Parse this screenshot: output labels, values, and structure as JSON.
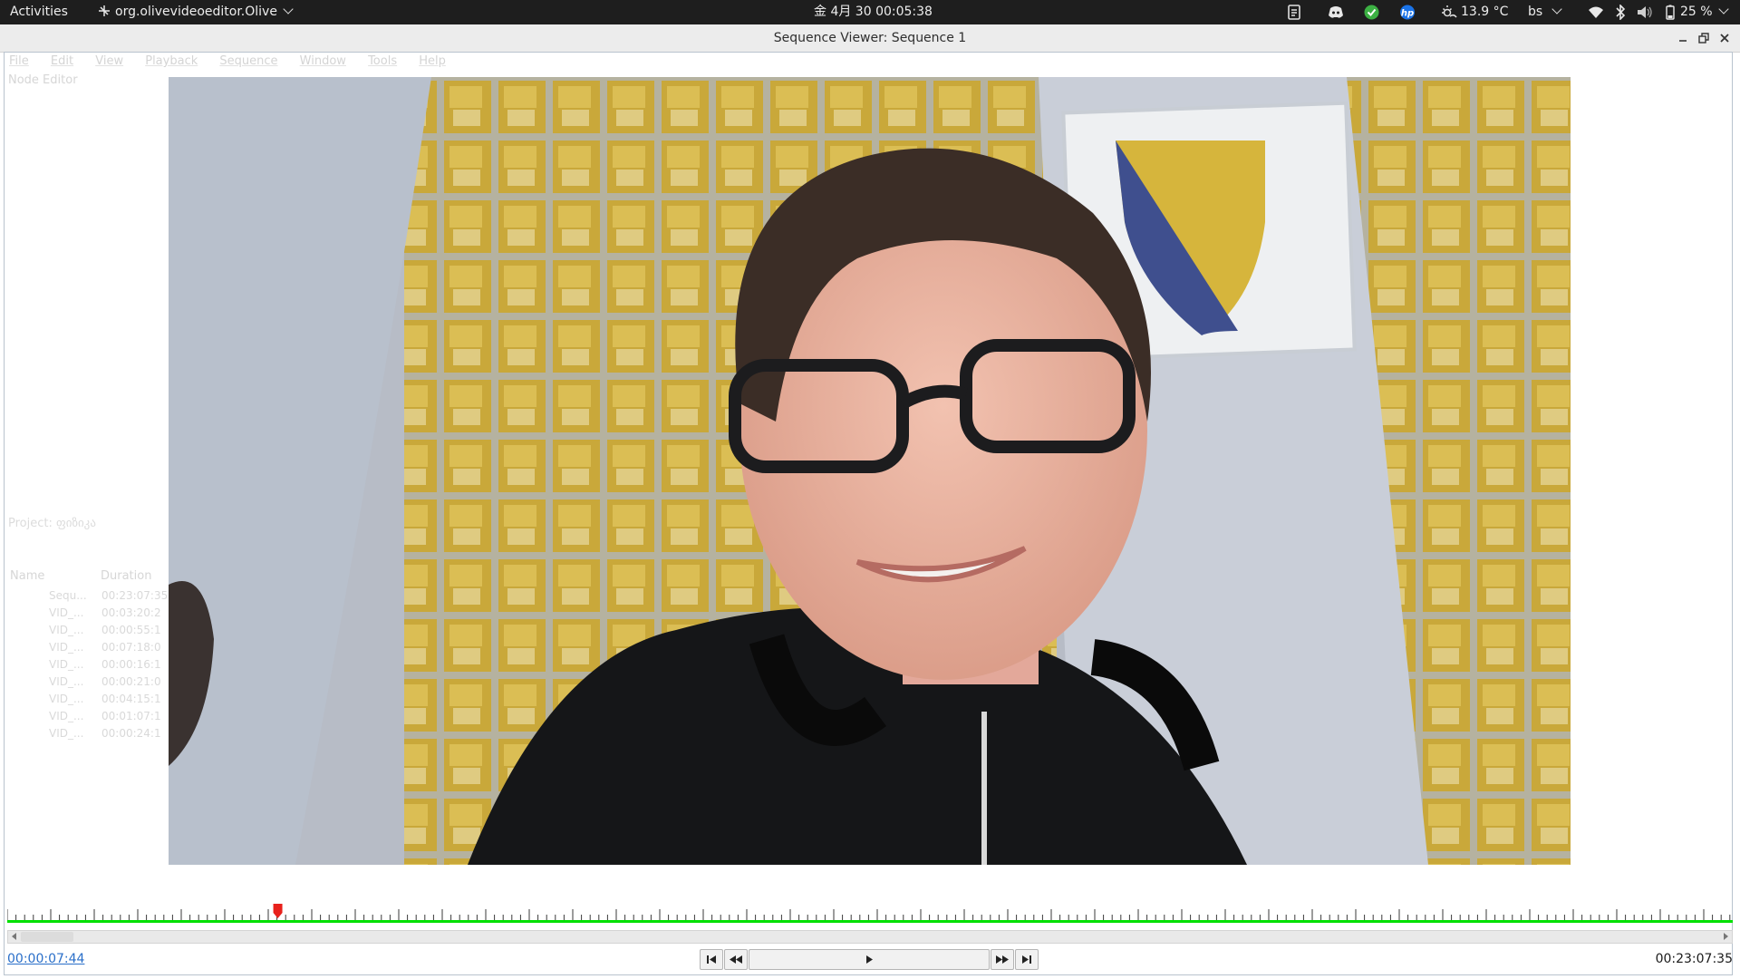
{
  "topbar": {
    "activities": "Activities",
    "app_name": "org.olivevideoeditor.Olive",
    "datetime": "金 4月 30  00:05:38",
    "temperature": "13.9 °C",
    "keyboard": "bs",
    "battery": "25 %",
    "tray_icons": [
      "notes-icon",
      "discord-icon",
      "check-icon",
      "hp-icon",
      "weather-icon",
      "wifi-icon",
      "bluetooth-icon",
      "volume-icon",
      "battery-icon"
    ]
  },
  "window": {
    "title": "Sequence Viewer: Sequence 1",
    "controls": [
      "minimize-icon",
      "restore-icon",
      "close-icon"
    ]
  },
  "menu": [
    "File",
    "Edit",
    "View",
    "Playback",
    "Sequence",
    "Window",
    "Tools",
    "Help"
  ],
  "panels": {
    "node_editor": "Node Editor",
    "project": "Project: ფიზიკა",
    "columns": [
      "Name",
      "Duration"
    ],
    "items": [
      {
        "name": "Sequ...",
        "duration": "00:23:07:35"
      },
      {
        "name": "VID_...",
        "duration": "00:03:20:2"
      },
      {
        "name": "VID_...",
        "duration": "00:00:55:1"
      },
      {
        "name": "VID_...",
        "duration": "00:07:18:0"
      },
      {
        "name": "VID_...",
        "duration": "00:00:16:1"
      },
      {
        "name": "VID_...",
        "duration": "00:00:21:0"
      },
      {
        "name": "VID_...",
        "duration": "00:04:15:1"
      },
      {
        "name": "VID_...",
        "duration": "00:01:07:1"
      },
      {
        "name": "VID_...",
        "duration": "00:00:24:1"
      }
    ]
  },
  "viewer": {
    "current_time": "00:00:07:44",
    "total_time": "00:23:07:35",
    "playhead_fraction": 0.0056,
    "accent_color": "#00e000",
    "playhead_color": "#e8211c",
    "buttons": [
      "go-to-start",
      "previous-frame",
      "play",
      "next-frame",
      "go-to-end"
    ]
  }
}
